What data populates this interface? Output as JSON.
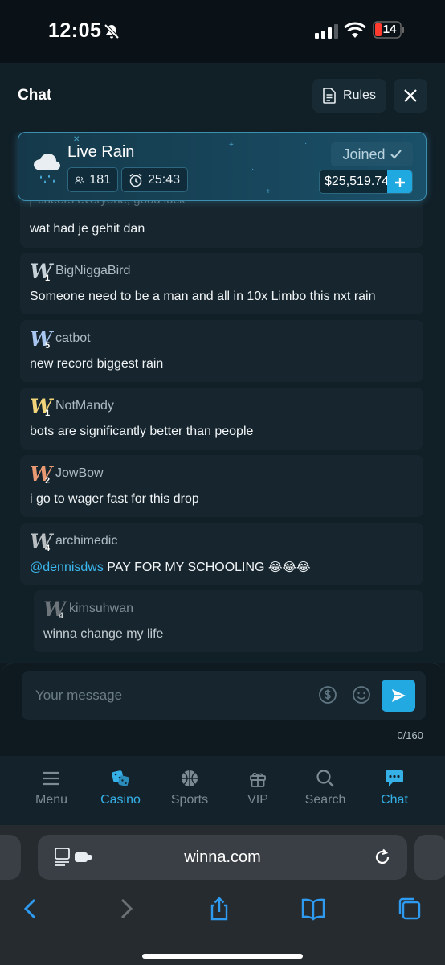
{
  "status_bar": {
    "time": "12:05",
    "battery": "14"
  },
  "header": {
    "title": "Chat",
    "rules_label": "Rules"
  },
  "rain": {
    "title": "Live Rain",
    "participants": "181",
    "timer": "25:43",
    "joined_label": "Joined",
    "amount": "$25,519.74"
  },
  "messages": [
    {
      "user": "",
      "text": "cheers everyone, good luck",
      "level": ""
    },
    {
      "user": "",
      "text": "wat had je gehit dan",
      "level": ""
    },
    {
      "user": "BigNiggaBird",
      "level": "1",
      "text": "Someone need to be a man and all in 10x Limbo this nxt rain",
      "badge_color": "#c7d2d8"
    },
    {
      "user": "catbot",
      "level": "5",
      "text": "new record biggest rain",
      "badge_color": "#a9c6f0"
    },
    {
      "user": "NotMandy",
      "level": "1",
      "text": "bots are significantly better than people",
      "badge_color": "#f2d57a"
    },
    {
      "user": "JowBow",
      "level": "2",
      "text": "i go to wager fast for this drop",
      "badge_color": "#e99a73"
    },
    {
      "user": "archimedic",
      "level": "4",
      "mention": "@dennisdws",
      "text": "PAY FOR MY SCHOOLING",
      "emoji": "😂😂😂",
      "badge_color": "#b9bec2"
    },
    {
      "user": "kimsuhwan",
      "level": "4",
      "text": "winna change my life",
      "badge_color": "#8b9195"
    }
  ],
  "composer": {
    "placeholder": "Your message",
    "counter": "0/160"
  },
  "nav": [
    {
      "label": "Menu",
      "icon": "menu-icon",
      "active": false
    },
    {
      "label": "Casino",
      "icon": "dice-icon",
      "active": true
    },
    {
      "label": "Sports",
      "icon": "basketball-icon",
      "active": false
    },
    {
      "label": "VIP",
      "icon": "gift-icon",
      "active": false
    },
    {
      "label": "Search",
      "icon": "search-icon",
      "active": false
    },
    {
      "label": "Chat",
      "icon": "chat-icon",
      "active": true
    }
  ],
  "browser": {
    "url": "winna.com"
  },
  "colors": {
    "accent": "#23a9e1",
    "background": "#0e1a20",
    "card": "#17262e"
  }
}
